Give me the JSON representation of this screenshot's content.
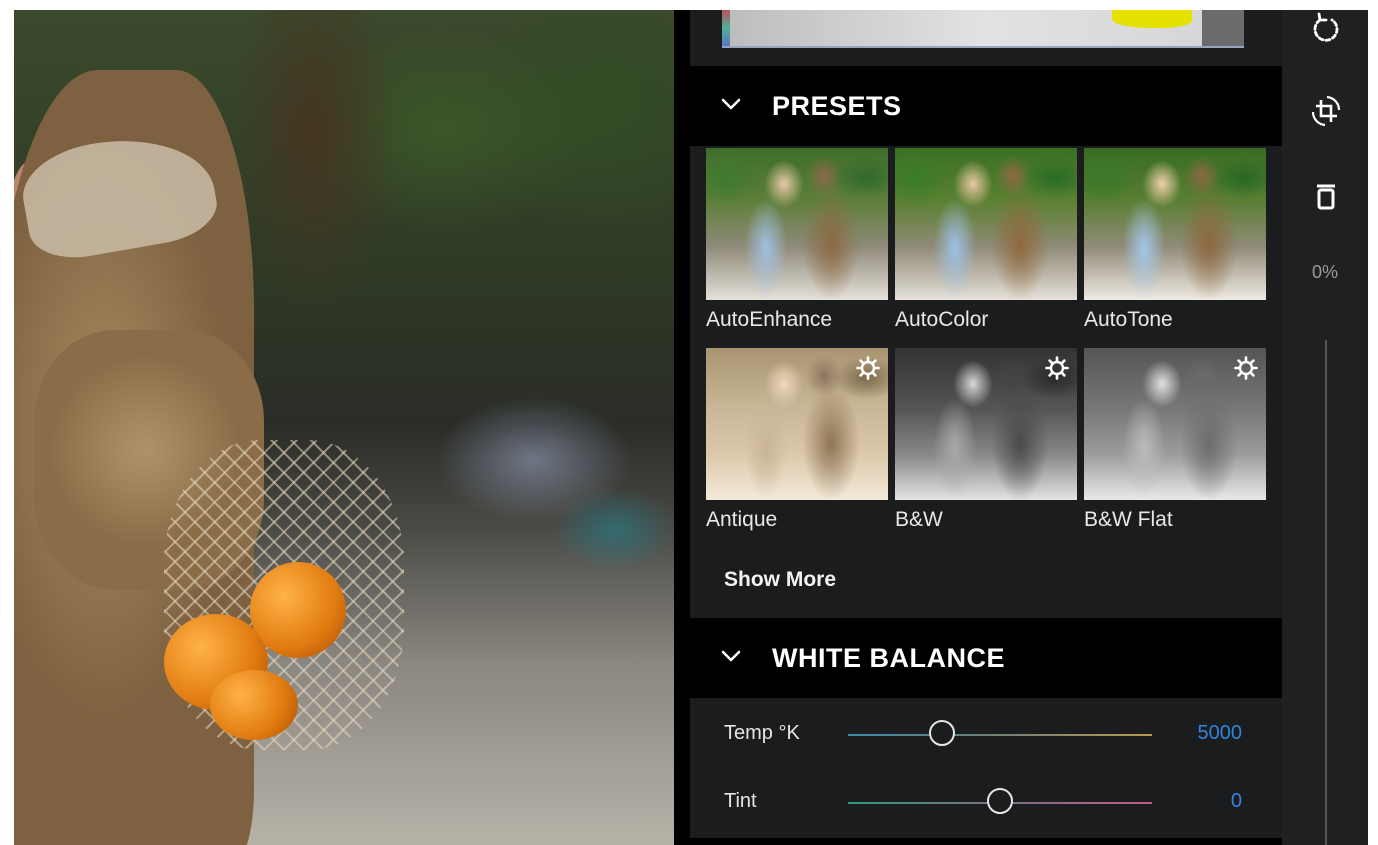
{
  "presets": {
    "title": "PRESETS",
    "items": [
      {
        "label": "AutoEnhance",
        "style": "color",
        "has_settings": false
      },
      {
        "label": "AutoColor",
        "style": "color",
        "has_settings": false
      },
      {
        "label": "AutoTone",
        "style": "color",
        "has_settings": false
      },
      {
        "label": "Antique",
        "style": "antique",
        "has_settings": true
      },
      {
        "label": "B&W",
        "style": "bw",
        "has_settings": true
      },
      {
        "label": "B&W Flat",
        "style": "bwflat",
        "has_settings": true
      }
    ],
    "show_more_label": "Show More"
  },
  "white_balance": {
    "title": "WHITE BALANCE",
    "temp": {
      "label": "Temp °K",
      "value": "5000",
      "slider_fraction": 0.31
    },
    "tint": {
      "label": "Tint",
      "value": "0",
      "slider_fraction": 0.5
    }
  },
  "toolbar": {
    "icons": [
      "rotate-icon",
      "crop-rotate-icon",
      "trash-icon"
    ],
    "zoom_label": "0%"
  },
  "colors": {
    "panel_bg": "#1b1c1e",
    "header_bg": "#000000",
    "value_accent": "#2e86de"
  }
}
